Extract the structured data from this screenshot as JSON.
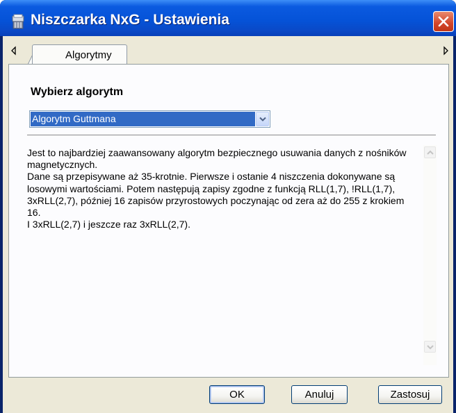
{
  "window": {
    "title": "Niszczarka NxG - Ustawienia",
    "app_icon": "shredder-icon",
    "close_icon": "close-icon"
  },
  "tabs": {
    "items": [
      {
        "label": "Algorytmy",
        "selected": true
      }
    ],
    "scroll_left_icon": "triangle-left-icon",
    "scroll_right_icon": "triangle-right-icon"
  },
  "algorithm": {
    "section_label": "Wybierz algorytm",
    "selected": "Algorytm Guttmana",
    "dropdown_icon": "chevron-down-icon"
  },
  "description": {
    "text": "Jest to najbardziej zaawansowany algorytm bezpiecznego usuwania danych z nośników magnetycznych.\nDane są przepisywane aż 35-krotnie. Pierwsze i ostanie 4 niszczenia dokonywane są losowymi wartościami. Potem następują zapisy zgodne z funkcją RLL(1,7), !RLL(1,7), 3xRLL(2,7), później 16 zapisów przyrostowych poczynając od zera aż do 255 z krokiem 16.\nI 3xRLL(2,7) i jeszcze raz 3xRLL(2,7).",
    "scroll_up_icon": "scroll-up-icon",
    "scroll_down_icon": "scroll-down-icon"
  },
  "buttons": {
    "ok": "OK",
    "cancel": "Anuluj",
    "apply": "Zastosuj"
  },
  "colors": {
    "titlebar": "#0553d8",
    "selection": "#316ac5",
    "close": "#d2452a",
    "dialog_bg": "#ece9d8"
  }
}
